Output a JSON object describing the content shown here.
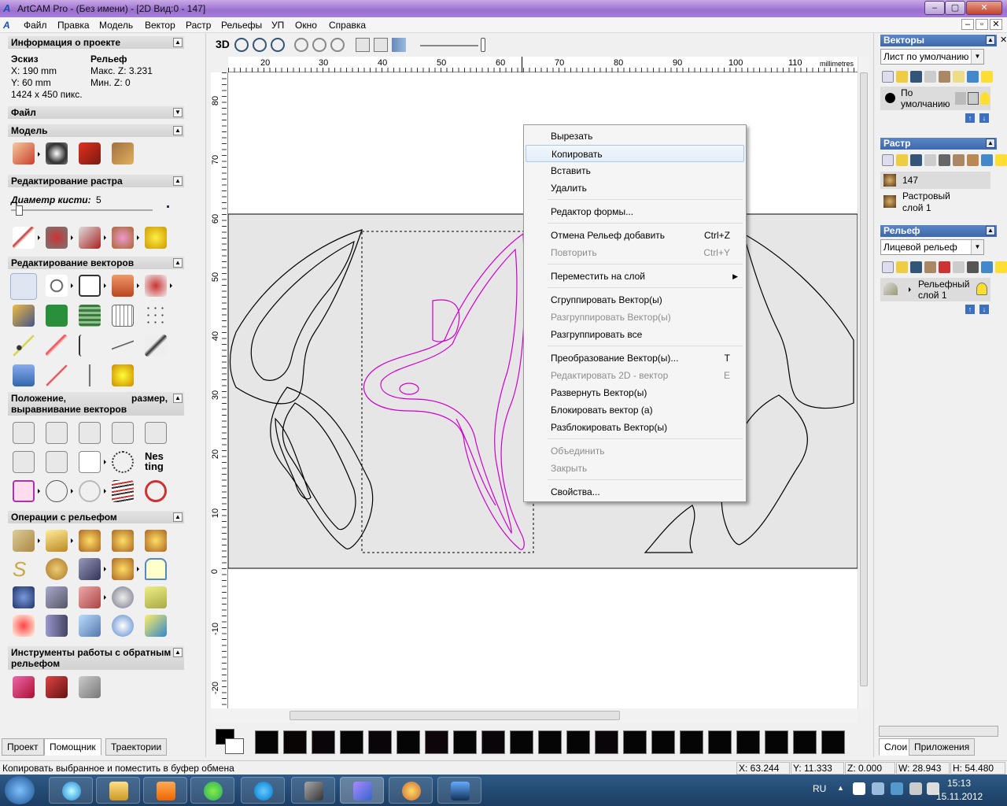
{
  "window": {
    "title": "ArtCAM Pro - (Без имени) - [2D Вид:0 - 147]",
    "controls": [
      "–",
      "▢",
      "✕"
    ],
    "inner_controls": [
      "–",
      "▫",
      "✕"
    ]
  },
  "menu": [
    "Файл",
    "Правка",
    "Модель",
    "Вектор",
    "Растр",
    "Рельефы",
    "УП",
    "Окно",
    "Справка"
  ],
  "left_panel": {
    "project_info": {
      "title": "Информация о проекте",
      "sketch_label": "Эскиз",
      "relief_label": "Рельеф",
      "x": "X: 190 mm",
      "y": "Y: 60 mm",
      "pixels": "1424 x 450 пикс.",
      "max_z": "Макс. Z: 3.231",
      "min_z": "Мин. Z: 0"
    },
    "sections": {
      "file": "Файл",
      "model": "Модель",
      "raster_edit": "Редактирование растра",
      "brush_label": "Диаметр кисти:",
      "brush_value": "5",
      "vector_edit": "Редактирование векторов",
      "position_a": "Положение,",
      "position_b": "размер,",
      "position_c": "выравнивание векторов",
      "relief_ops": "Операции с рельефом",
      "inverse_a": "Инструменты работы с обратным",
      "inverse_b": "рельефом"
    },
    "nesting_glyph": "Nes ting",
    "tabs": [
      "Проект",
      "Помощник",
      "Траектории"
    ],
    "active_tab": "Помощник"
  },
  "view_toolbar": {
    "mode": "3D"
  },
  "ruler": {
    "unit": "millimetres",
    "top_ticks": [
      "20",
      "30",
      "40",
      "50",
      "60",
      "70",
      "80",
      "90",
      "100",
      "110"
    ],
    "left_ticks": [
      "80",
      "70",
      "60",
      "50",
      "40",
      "30",
      "20",
      "10",
      "0",
      "-10",
      "-20"
    ]
  },
  "context_menu": [
    {
      "label": "Вырезать",
      "shortcut": "",
      "disabled": false
    },
    {
      "label": "Копировать",
      "shortcut": "",
      "disabled": false,
      "highlighted": true
    },
    {
      "label": "Вставить",
      "shortcut": "",
      "disabled": false
    },
    {
      "label": "Удалить",
      "shortcut": "",
      "disabled": false
    },
    {
      "label": "Редактор формы...",
      "shortcut": "",
      "disabled": false
    },
    {
      "label": "Отмена Рельеф добавить",
      "shortcut": "Ctrl+Z",
      "disabled": false
    },
    {
      "label": "Повторить",
      "shortcut": "Ctrl+Y",
      "disabled": true
    },
    {
      "label": "Переместить на слой",
      "shortcut": "▶",
      "disabled": false
    },
    {
      "label": "Сгруппировать Вектор(ы)",
      "shortcut": "",
      "disabled": false
    },
    {
      "label": "Разгруппировать Вектор(ы)",
      "shortcut": "",
      "disabled": true
    },
    {
      "label": "Разгруппировать все",
      "shortcut": "",
      "disabled": false
    },
    {
      "label": "Преобразование Вектор(ы)...",
      "shortcut": "T",
      "disabled": false
    },
    {
      "label": "Редактировать 2D - вектор",
      "shortcut": "E",
      "disabled": true
    },
    {
      "label": "Развернуть Вектор(ы)",
      "shortcut": "",
      "disabled": false
    },
    {
      "label": "Блокировать вектор (а)",
      "shortcut": "",
      "disabled": false
    },
    {
      "label": "Разблокировать Вектор(ы)",
      "shortcut": "",
      "disabled": false
    },
    {
      "label": "Объединить",
      "shortcut": "",
      "disabled": true
    },
    {
      "label": "Закрыть",
      "shortcut": "",
      "disabled": true
    },
    {
      "label": "Свойства...",
      "shortcut": "",
      "disabled": false
    }
  ],
  "right_panel": {
    "vectors_title": "Векторы",
    "vectors_sheet": "Лист по умолчанию",
    "vectors_layer_a": "По",
    "vectors_layer_b": "умолчанию",
    "raster_title": "Растр",
    "raster_item": "147",
    "raster_layer_a": "Растровый",
    "raster_layer_b": "слой 1",
    "relief_title": "Рельеф",
    "relief_combo": "Лицевой рельеф",
    "relief_layer_a": "Рельефный",
    "relief_layer_b": "слой 1",
    "tabs": [
      "Слои",
      "Приложения"
    ],
    "active_tab": "Слои"
  },
  "status": {
    "message": "Копировать выбранное и поместить в буфер обмена",
    "x": "X: 63.244",
    "y": "Y: 11.333",
    "z": "Z: 0.000",
    "w": "W: 28.943",
    "h": "H: 54.480"
  },
  "taskbar": {
    "lang": "RU",
    "time": "15:13",
    "date": "15.11.2012"
  },
  "colors": {
    "selected_vector": "#cc00cc",
    "vector": "#000000",
    "relief_band": "#e6e6e6",
    "panel_header": "#3c68ad"
  }
}
